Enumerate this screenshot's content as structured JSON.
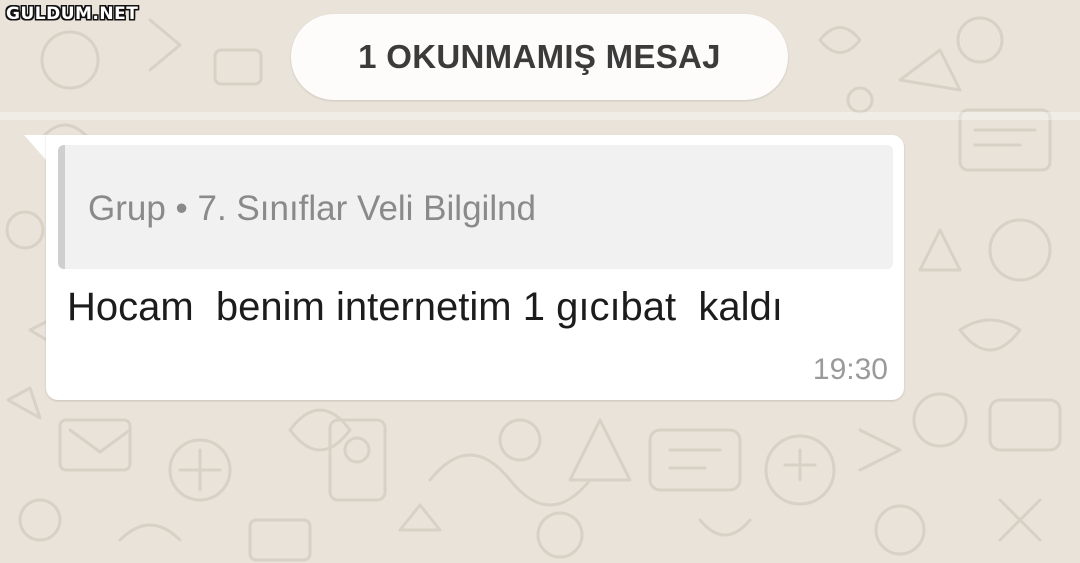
{
  "watermark": "GULDUM.NET",
  "chat": {
    "unread_banner": "1 OKUNMAMIŞ MESAJ",
    "message": {
      "quoted_source": "Grup • 7. Sınıflar Veli Bilgilnd",
      "text": "Hocam  benim internetim 1 gıcıbat  kaldı",
      "time": "19:30"
    }
  },
  "colors": {
    "wallpaper": "#e9e3d9",
    "bubble": "#ffffff",
    "quote_background": "#f1f1f1",
    "quote_bar": "#cfcfcf"
  }
}
